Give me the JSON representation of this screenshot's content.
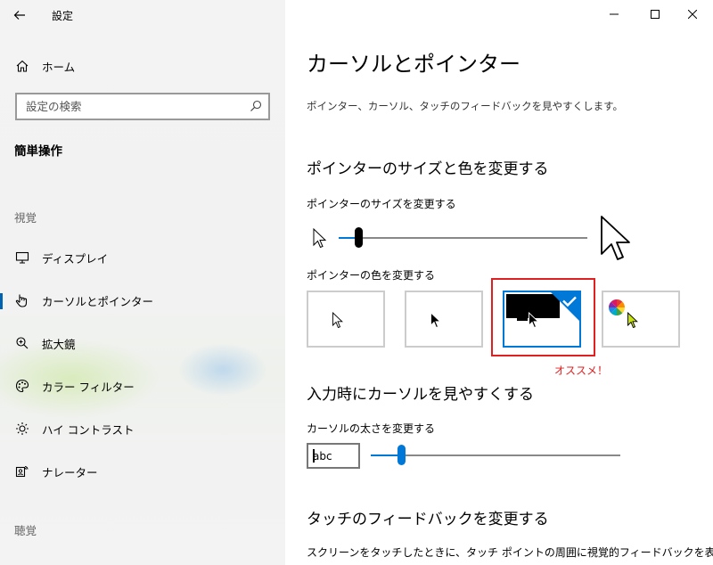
{
  "window": {
    "title": "設定"
  },
  "sidebar": {
    "home_label": "ホーム",
    "search_placeholder": "設定の検索",
    "section_heading": "簡単操作",
    "categories": {
      "vision": "視覚",
      "hearing": "聴覚"
    },
    "items": [
      {
        "label": "ディスプレイ",
        "icon": "monitor-icon"
      },
      {
        "label": "カーソルとポインター",
        "icon": "pointer-hand-icon",
        "active": true
      },
      {
        "label": "拡大鏡",
        "icon": "magnifier-icon"
      },
      {
        "label": "カラー フィルター",
        "icon": "palette-icon"
      },
      {
        "label": "ハイ コントラスト",
        "icon": "sun-icon"
      },
      {
        "label": "ナレーター",
        "icon": "narrator-icon"
      }
    ]
  },
  "main": {
    "title": "カーソルとポインター",
    "description": "ポインター、カーソル、タッチのフィードバックを見やすくします。",
    "pointer_section": {
      "heading": "ポインターのサイズと色を変更する",
      "size_label": "ポインターのサイズを変更する",
      "size_value_fraction": 0.08,
      "color_label": "ポインターの色を変更する",
      "color_options": [
        {
          "name": "white",
          "selected": false
        },
        {
          "name": "black",
          "selected": false
        },
        {
          "name": "inverted",
          "selected": true
        },
        {
          "name": "custom",
          "selected": false
        }
      ],
      "annotation": "オススメ！"
    },
    "cursor_section": {
      "heading": "入力時にカーソルを見やすくする",
      "thickness_label": "カーソルの太さを変更する",
      "preview_text": "abc",
      "thickness_value_fraction": 0.12
    },
    "touch_section": {
      "heading": "タッチのフィードバックを変更する",
      "text": "スクリーンをタッチしたときに、タッチ ポイントの周囲に視覚的フィードバックを表"
    }
  },
  "colors": {
    "accent": "#0078d7",
    "annotation": "#e02020"
  }
}
